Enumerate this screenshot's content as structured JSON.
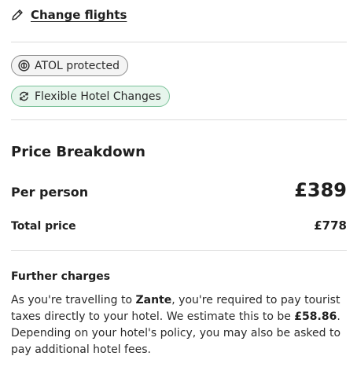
{
  "change_flights": {
    "label": "Change flights",
    "icon": "pencil-icon"
  },
  "badges": [
    {
      "label": "ATOL protected",
      "icon": "atol-icon",
      "border": "#8c8c8c",
      "background": "#f4f4f4"
    },
    {
      "label": "Flexible Hotel Changes",
      "icon": "flexible-change-icon",
      "border": "#7cc29a",
      "background": "#e6f5ec"
    }
  ],
  "price_breakdown": {
    "title": "Price Breakdown",
    "per_person": {
      "label": "Per person",
      "value": "£389"
    },
    "total": {
      "label": "Total price",
      "value": "£778"
    }
  },
  "further_charges": {
    "title": "Further charges",
    "text_1": "As you're travelling to ",
    "destination": "Zante",
    "text_2": ", you're required to pay tourist taxes directly to your hotel. We estimate this to be ",
    "estimate": "£58.86",
    "text_3": ". Depending on your hotel's policy, you may also be asked to pay additional hotel fees."
  }
}
